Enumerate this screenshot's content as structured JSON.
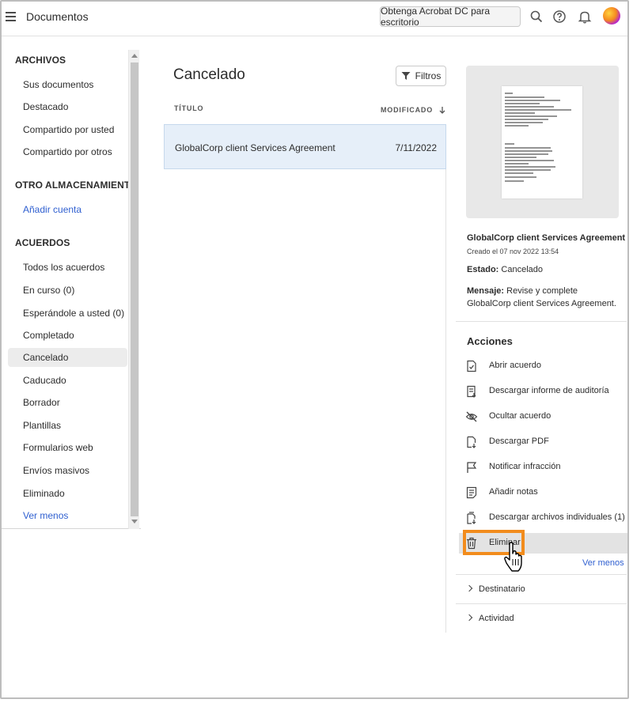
{
  "header": {
    "menu_icon": "hamburger-icon",
    "title": "Documentos",
    "acrobat_button": "Obtenga Acrobat DC para escritorio",
    "icons": [
      "search-icon",
      "help-icon",
      "bell-icon",
      "avatar"
    ]
  },
  "sidebar": {
    "section_files": "ARCHIVOS",
    "files": [
      "Sus documentos",
      "Destacado",
      "Compartido por usted",
      "Compartido por otros"
    ],
    "section_storage": "OTRO ALMACENAMIENTO",
    "add_account": "Añadir cuenta",
    "section_agreements": "ACUERDOS",
    "agreements": [
      "Todos los acuerdos",
      "En curso (0)",
      "Esperándole a usted (0)",
      "Completado",
      "Cancelado",
      "Caducado",
      "Borrador",
      "Plantillas",
      "Formularios web",
      "Envíos masivos",
      "Eliminado"
    ],
    "active_item": "Cancelado",
    "see_less": "Ver menos"
  },
  "main": {
    "title": "Cancelado",
    "filters_button": "Filtros",
    "col_title": "TÍTULO",
    "col_modified": "MODIFICADO",
    "rows": [
      {
        "title": "GlobalCorp client Services Agreement",
        "date": "7/11/2022"
      }
    ]
  },
  "details": {
    "name": "GlobalCorp client Services Agreement",
    "created": "Creado el 07 nov 2022 13:54",
    "state_label": "Estado:",
    "state_value": "Cancelado",
    "message_label": "Mensaje:",
    "message_value": "Revise y complete GlobalCorp client Services Agreement.",
    "actions_title": "Acciones",
    "actions": [
      {
        "label": "Abrir acuerdo",
        "icon": "open-agreement-icon"
      },
      {
        "label": "Descargar informe de auditoría",
        "icon": "audit-report-icon"
      },
      {
        "label": "Ocultar acuerdo",
        "icon": "hide-eye-icon"
      },
      {
        "label": "Descargar PDF",
        "icon": "download-pdf-icon"
      },
      {
        "label": "Notificar infracción",
        "icon": "flag-icon"
      },
      {
        "label": "Añadir notas",
        "icon": "notes-icon"
      },
      {
        "label": "Descargar archivos individuales (1)",
        "icon": "download-files-icon"
      },
      {
        "label": "Eliminar",
        "icon": "trash-icon"
      }
    ],
    "see_less": "Ver menos",
    "recipient": "Destinatario",
    "activity": "Actividad"
  },
  "colors": {
    "accent": "#2f5fd0",
    "highlight": "#f28c1d",
    "selected_row": "#e6eff9"
  }
}
